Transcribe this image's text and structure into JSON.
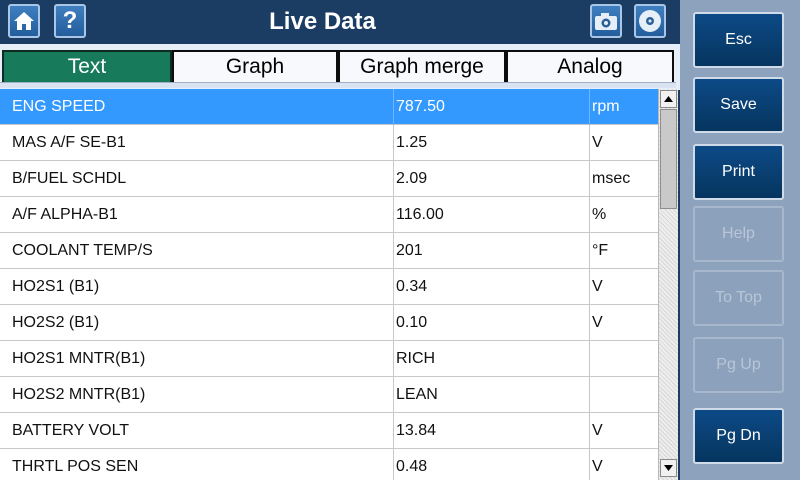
{
  "header": {
    "title": "Live Data",
    "home_icon": "home-icon",
    "help_icon": "help-icon",
    "camera_icon": "camera-icon",
    "disc_icon": "disc-icon"
  },
  "tabs": [
    {
      "label": "Text",
      "active": true
    },
    {
      "label": "Graph",
      "active": false
    },
    {
      "label": "Graph merge",
      "active": false
    },
    {
      "label": "Analog",
      "active": false
    }
  ],
  "table": {
    "rows": [
      {
        "name": "ENG SPEED",
        "value": "787.50",
        "unit": "rpm",
        "selected": true
      },
      {
        "name": "MAS A/F SE-B1",
        "value": "1.25",
        "unit": "V",
        "selected": false
      },
      {
        "name": "B/FUEL SCHDL",
        "value": "2.09",
        "unit": "msec",
        "selected": false
      },
      {
        "name": "A/F ALPHA-B1",
        "value": "116.00",
        "unit": "%",
        "selected": false
      },
      {
        "name": "COOLANT TEMP/S",
        "value": "201",
        "unit": "°F",
        "selected": false
      },
      {
        "name": "HO2S1 (B1)",
        "value": "0.34",
        "unit": "V",
        "selected": false
      },
      {
        "name": "HO2S2 (B1)",
        "value": "0.10",
        "unit": "V",
        "selected": false
      },
      {
        "name": "HO2S1 MNTR(B1)",
        "value": "RICH",
        "unit": "",
        "selected": false
      },
      {
        "name": "HO2S2 MNTR(B1)",
        "value": "LEAN",
        "unit": "",
        "selected": false
      },
      {
        "name": "BATTERY VOLT",
        "value": "13.84",
        "unit": "V",
        "selected": false
      },
      {
        "name": "THRTL POS SEN",
        "value": "0.48",
        "unit": "V",
        "selected": false
      }
    ]
  },
  "sidebar": {
    "buttons": [
      {
        "label": "Esc",
        "enabled": true
      },
      {
        "label": "Save",
        "enabled": true
      },
      {
        "label": "Print",
        "enabled": true
      },
      {
        "label": "Help",
        "enabled": false
      },
      {
        "label": "To Top",
        "enabled": false
      },
      {
        "label": "Pg Up",
        "enabled": false
      },
      {
        "label": "Pg Dn",
        "enabled": true
      }
    ]
  },
  "colors": {
    "header_bg": "#1c3d63",
    "tab_active": "#177a5a",
    "row_selected": "#3399ff",
    "sidebar_bg": "#8da2bd",
    "button_enabled": "#0d4a86"
  }
}
